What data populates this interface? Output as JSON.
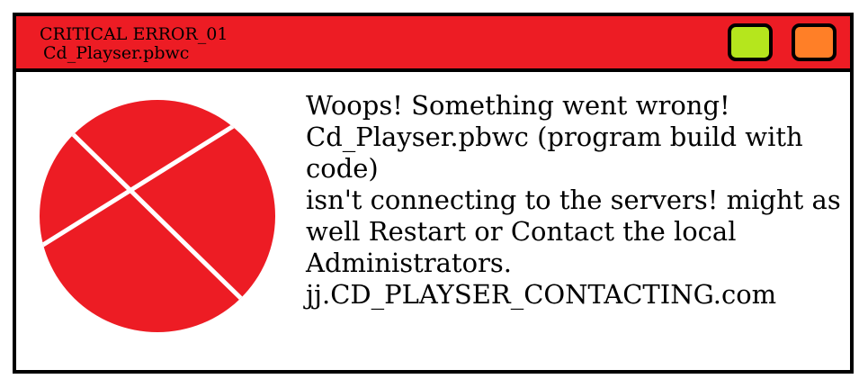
{
  "window": {
    "title": "CRITICAL ERROR_01",
    "subtitle": "Cd_Playser.pbwc",
    "titlebar_color": "#ed1c24",
    "controls": [
      {
        "name": "green-window-button",
        "color": "#b5e61d"
      },
      {
        "name": "orange-window-button",
        "color": "#ff7f27"
      }
    ]
  },
  "icon": {
    "name": "error-cross-icon",
    "color": "#ed1c24"
  },
  "message": {
    "lines": [
      "Woops! Something went wrong!",
      "Cd_Playser.pbwc (program build with",
      "code)",
      "isn't connecting to the servers! might as",
      "well Restart or Contact the local",
      "Administrators.",
      "jj.CD_PLAYSER_CONTACTING.com"
    ]
  }
}
